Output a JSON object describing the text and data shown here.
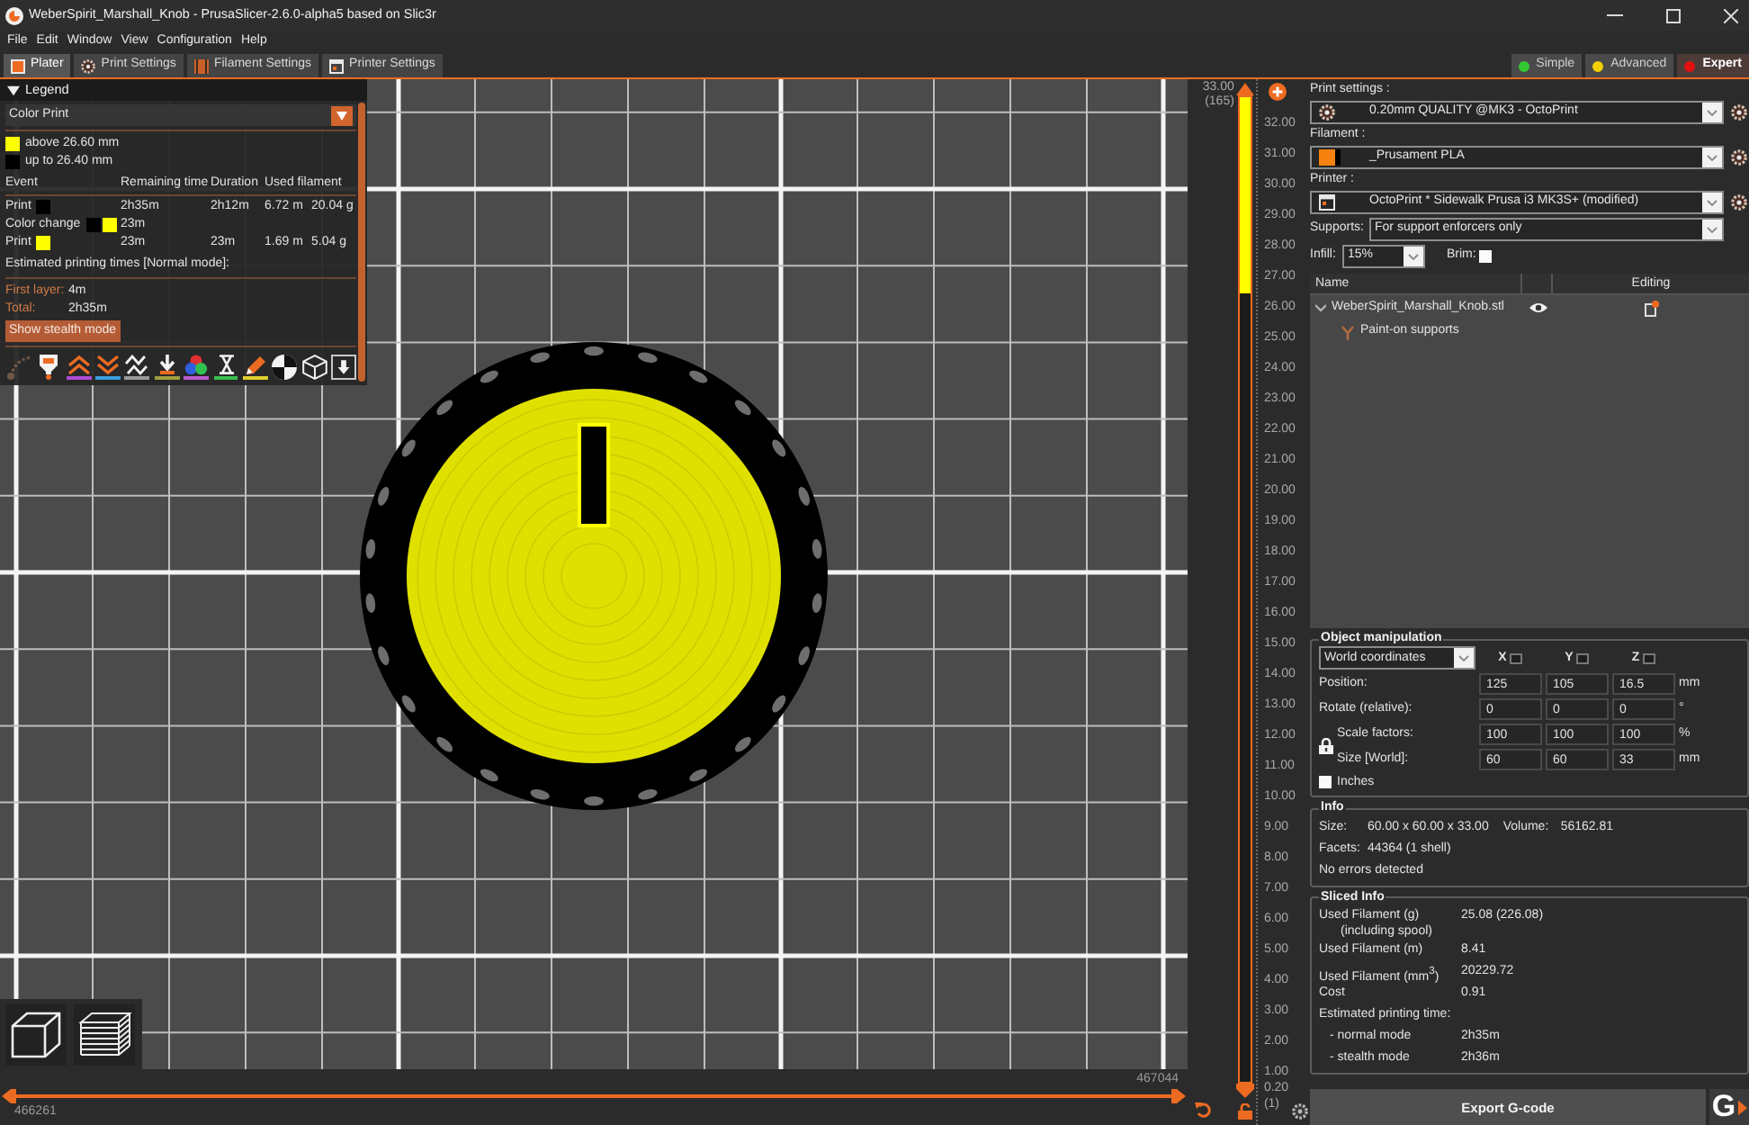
{
  "window": {
    "title": "WeberSpirit_Marshall_Knob - PrusaSlicer-2.6.0-alpha5 based on Slic3r"
  },
  "menu": [
    "File",
    "Edit",
    "Window",
    "View",
    "Configuration",
    "Help"
  ],
  "tabs": [
    {
      "label": "Plater",
      "kind": "plater",
      "selected": true
    },
    {
      "label": "Print Settings",
      "kind": "print",
      "selected": false
    },
    {
      "label": "Filament Settings",
      "kind": "filament",
      "selected": false
    },
    {
      "label": "Printer Settings",
      "kind": "printer",
      "selected": false
    }
  ],
  "modes": [
    {
      "label": "Simple",
      "color": "#34c934",
      "selected": false
    },
    {
      "label": "Advanced",
      "color": "#f2d000",
      "selected": false
    },
    {
      "label": "Expert",
      "color": "#e31010",
      "selected": true
    }
  ],
  "legend": {
    "title": "Legend",
    "expanded": true,
    "view_type": "Color Print",
    "color_ranges": [
      {
        "label": "above 26.60 mm",
        "color": "#ffff00"
      },
      {
        "label": "up to 26.40 mm",
        "color": "#000000"
      }
    ],
    "columns": [
      "Event",
      "Remaining time",
      "Duration",
      "Used filament"
    ],
    "rows": [
      {
        "event": "Print",
        "swatches": [
          {
            "color": "#000000"
          }
        ],
        "remaining": "2h35m",
        "duration": "2h12m",
        "length": "6.72 m",
        "weight": "20.04 g"
      },
      {
        "event": "Color change",
        "swatches": [
          {
            "color": "#000000"
          },
          {
            "color": "#ffff00"
          }
        ],
        "remaining": "23m"
      },
      {
        "event": "Print",
        "swatches": [
          {
            "color": "#ffff00"
          }
        ],
        "remaining": "23m",
        "duration": "23m",
        "length": "1.69 m",
        "weight": "5.04 g"
      }
    ],
    "estimate_title": "Estimated printing times [Normal mode]:",
    "times": [
      {
        "label": "First layer:",
        "value": "4m"
      },
      {
        "label": "Total:",
        "value": "2h35m"
      }
    ],
    "mode_button": "Show stealth mode",
    "toolbar": [
      {
        "kind": "travel",
        "on": false,
        "selected": false
      },
      {
        "kind": "wipe",
        "on": true,
        "selected": false
      },
      {
        "kind": "retractions",
        "on": true,
        "selected": false
      },
      {
        "kind": "deretractions",
        "on": true,
        "selected": false
      },
      {
        "kind": "seams",
        "on": true,
        "selected": false
      },
      {
        "kind": "tool-changes",
        "on": true,
        "selected": false
      },
      {
        "kind": "color-changes",
        "on": true,
        "selected": false
      },
      {
        "kind": "pauses",
        "on": true,
        "selected": false
      },
      {
        "kind": "custom-gcodes",
        "on": true,
        "selected": false
      },
      {
        "kind": "center-of-gravity",
        "on": true,
        "selected": false
      },
      {
        "kind": "shells",
        "on": true,
        "selected": false
      },
      {
        "kind": "tool-marker",
        "on": true,
        "selected": true
      }
    ]
  },
  "vertical_slider": {
    "top_value": "33.00",
    "top_layer": "(165)",
    "ticks": [
      "32.00",
      "31.00",
      "30.00",
      "29.00",
      "28.00",
      "27.00",
      "26.00",
      "25.00",
      "24.00",
      "23.00",
      "22.00",
      "21.00",
      "20.00",
      "19.00",
      "18.00",
      "17.00",
      "16.00",
      "15.00",
      "14.00",
      "13.00",
      "12.00",
      "11.00",
      "10.00",
      "9.00",
      "8.00",
      "7.00",
      "6.00",
      "5.00",
      "4.00",
      "3.00",
      "2.00",
      "1.00"
    ],
    "bottom_value": "0.20",
    "bottom_layer": "(1)",
    "fill": {
      "color": "#ffff00",
      "level": 0.2
    }
  },
  "horizontal_slider": {
    "upper_value": "467044",
    "lower_value": "466261"
  },
  "sidebar": {
    "presets": [
      {
        "label": "Print settings :",
        "value": "0.20mm QUALITY @MK3 - OctoPrint",
        "kind": "print"
      },
      {
        "label": "Filament :",
        "value": "_Prusament PLA",
        "kind": "filament",
        "color": "#f5820f"
      },
      {
        "label": "Printer :",
        "value": "OctoPrint * Sidewalk Prusa i3 MK3S+ (modified)",
        "kind": "printer"
      }
    ],
    "supports": {
      "label": "Supports:",
      "value": "For support enforcers only"
    },
    "infill": {
      "label": "Infill:",
      "value": "15%"
    },
    "brim": {
      "label": "Brim:",
      "checked": false
    },
    "object_list": {
      "columns": [
        "Name",
        "Editing"
      ],
      "objects": [
        {
          "name": "WeberSpirit_Marshall_Knob.stl",
          "expanded": true,
          "children": [
            {
              "name": "Paint-on supports"
            }
          ]
        }
      ]
    },
    "manipulation": {
      "title": "Object manipulation",
      "coordinates": "World coordinates",
      "axes": [
        "X",
        "Y",
        "Z"
      ],
      "transform_rows": [
        {
          "label": "Position:",
          "values": [
            "125",
            "105",
            "16.5"
          ],
          "unit": "mm"
        },
        {
          "label": "Rotate (relative):",
          "values": [
            "0",
            "0",
            "0"
          ],
          "unit": "°"
        }
      ],
      "scale_rows": [
        {
          "label": "Scale factors:",
          "values": [
            "100",
            "100",
            "100"
          ],
          "unit": "%"
        },
        {
          "label": "Size [World]:",
          "values": [
            "60",
            "60",
            "33"
          ],
          "unit": "mm"
        }
      ],
      "inches": {
        "label": "Inches",
        "checked": false
      }
    },
    "info": {
      "title": "Info",
      "rows": [
        {
          "label": "Size:",
          "value": "60.00 x 60.00 x 33.00",
          "extra_label": "Volume:",
          "extra_value": "56162.81"
        },
        {
          "label": "Facets:",
          "value": "44364 (1 shell)"
        },
        {
          "label": "No errors detected"
        }
      ]
    },
    "sliced_info": {
      "title": "Sliced Info",
      "rows": [
        {
          "label": "Used Filament (g)",
          "sublabel": "(including spool)",
          "value": "25.08 (226.08)"
        },
        {
          "label": "Used Filament (m)",
          "value": "8.41"
        },
        {
          "label": "Used Filament (mm$^{3}$)",
          "value": "20229.72"
        },
        {
          "label": "Cost",
          "value": "0.91"
        },
        {
          "label": "Estimated printing time:",
          "children": [
            {
              "label": "- normal mode",
              "value": "2h35m"
            },
            {
              "label": "- stealth mode",
              "value": "2h36m"
            }
          ]
        }
      ]
    },
    "export_button": "Export G-code",
    "send_button": "G"
  }
}
